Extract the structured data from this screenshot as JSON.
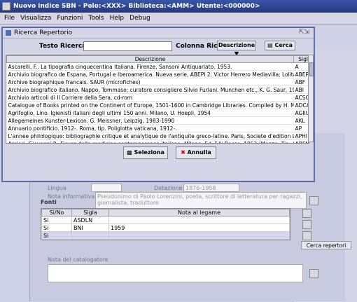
{
  "window": {
    "title": "Nuovo indice SBN - Polo:<XXX> Biblioteca:<AMM> Utente:<000000>"
  },
  "menu": [
    "File",
    "Visualizza",
    "Funzioni",
    "Tools",
    "Help",
    "Debug"
  ],
  "dialog": {
    "title": "Ricerca Repertorio",
    "search_label": "Testo Ricerca",
    "column_label": "Colonna Ricerca",
    "column_value": "Descrizione",
    "search_button": "Cerca",
    "headers": [
      "Descrizione",
      "Sigla"
    ],
    "rows": [
      [
        "Ascarelli, F.. La tipografia cinquecentina italiana. Firenze, Sansoni Antiquariato, 1953.",
        "A"
      ],
      [
        "Archivio biografico de Espana, Portugal e Iberoamerica. Nueva serie, ABEPI 2. Victor Herrero Mediavilla; Lolita Aguayo Na...",
        "ABEPI"
      ],
      [
        "Archive biographique francais. SAUR (microfiches)",
        "ABF"
      ],
      [
        "Archivio biografico italiano. Nappo, Tommaso; curatore consigliere Silvio Furlani. Munchen etc., K. G. Saur, 1987-1996. (M...",
        "ABI"
      ],
      [
        "Archivio articoli di Il Corriere della Sera, cd-rom",
        "ACSCD"
      ],
      [
        "Catalogue of Books printed on the Continent of Europe, 1501-1600 in Cambridge Libraries. Compiled by H. M. Adams. C...",
        "ADCAM"
      ],
      [
        "Agrifoglio, Lino. Igienisti italiani degli ultimi 150 anni. Milano, U. Hoepli, 1954",
        "AGIIU"
      ],
      [
        "Allegemeines Kunster-Lexicon. G. Meissner, Leipzig, 1983-1990",
        "AKL"
      ],
      [
        "Annuario pontificio. 1912-. Roma, tip. Poliglotta vaticana, 1912-.",
        "AP"
      ],
      [
        "L'annee philologique: bibliographie critique et analytique de l'antiquite greco-latine. Paris, Societe d'edition Le belles lettr...",
        "APHI"
      ],
      [
        "Arcieri, Giovanni P.. Figure della medicina contemporanea italiana. Milano, Ed. F.lli Bocca, 1952 (Monza, Tip. Artigianelli)",
        "ARFMI"
      ]
    ],
    "select_button": "Seleziona",
    "cancel_button": "Annulla"
  },
  "background": {
    "lingua_label": "Lingua",
    "datazione_label": "Datazione",
    "datazione_value": "1876-1958",
    "nota_label": "Nota informativa",
    "nota_value": "Pseudonimo di Paolo Lorenzini, poeta, scrittore di letteratura per ragazzi, giornalista, traduttore",
    "fonti_label": "Fonti",
    "fonti_headers": [
      "Si/No",
      "Sigla",
      "Nota al legame"
    ],
    "fonti_rows": [
      [
        "Si",
        "ASDLN",
        ""
      ],
      [
        "Si",
        "BNI",
        "1959"
      ],
      [
        "Si",
        "",
        ""
      ]
    ],
    "cerca_repertori": "Cerca repertori",
    "nota_catalogatore_label": "Nota del catalogatore"
  }
}
